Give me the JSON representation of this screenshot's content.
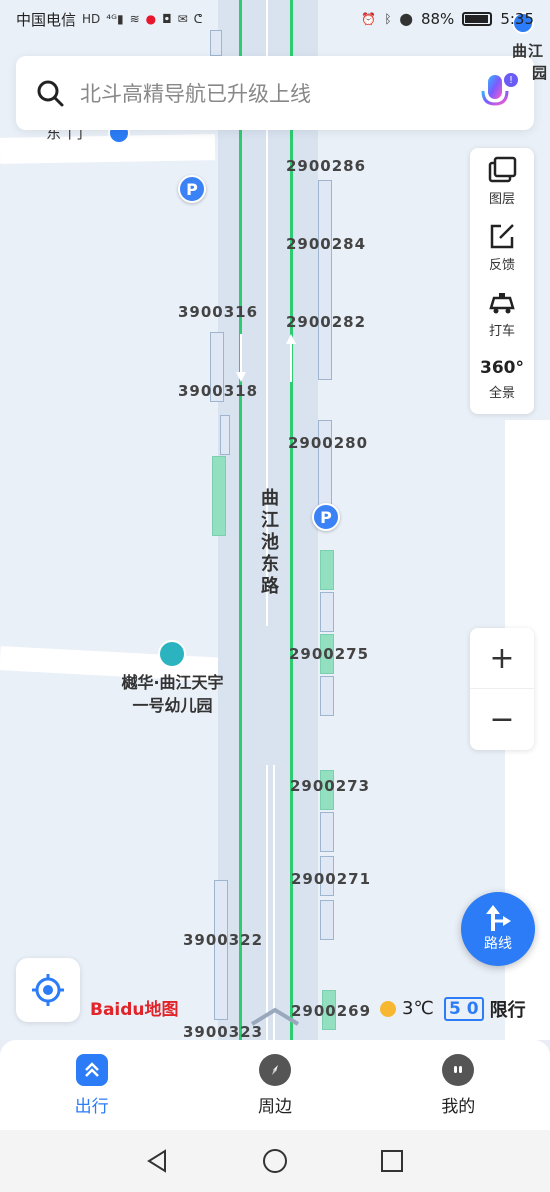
{
  "status_bar": {
    "carrier": "中国电信",
    "battery_percent": "88%",
    "battery_level": 0.88,
    "time": "5:35"
  },
  "search": {
    "placeholder": "北斗高精导航已升级上线"
  },
  "map": {
    "road_name": "曲江池东路",
    "poi_name_line1": "樾华·曲江天宇",
    "poi_name_line2": "一号幼儿园",
    "top_right_partial_1": "曲江",
    "top_right_partial_2": "园",
    "top_left_partial": "东 门",
    "parking_label": "P",
    "labels_left": [
      "3900316",
      "3900318",
      "3900322",
      "3900323"
    ],
    "labels_right": [
      "2900286",
      "2900284",
      "2900282",
      "2900280",
      "2900275",
      "2900273",
      "2900271",
      "2900269"
    ]
  },
  "tools": [
    {
      "label": "图层",
      "icon": "layers-icon"
    },
    {
      "label": "反馈",
      "icon": "feedback-edit-icon"
    },
    {
      "label": "打车",
      "icon": "taxi-icon"
    },
    {
      "label": "全景",
      "icon": "panorama-360-icon",
      "badge": "360°"
    }
  ],
  "zoom": {
    "in": "+",
    "out": "−"
  },
  "route_button": {
    "label": "路线"
  },
  "baidu_logo": "Baidu地图",
  "weather": {
    "temp": "3℃"
  },
  "restriction": {
    "number": "5 0",
    "label": "限行"
  },
  "bottom_nav": [
    {
      "label": "出行",
      "active": true
    },
    {
      "label": "周边",
      "active": false
    },
    {
      "label": "我的",
      "active": false
    }
  ],
  "colors": {
    "accent": "#2b7cf6",
    "lane_green": "#2ecc71",
    "parking_blue": "#3b82f6"
  }
}
